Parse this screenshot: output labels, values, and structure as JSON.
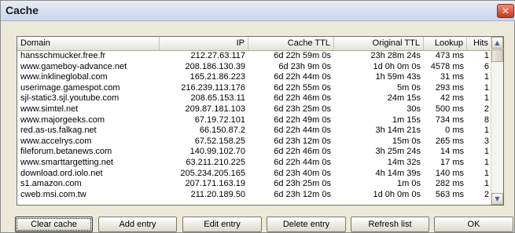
{
  "window": {
    "title": "Cache",
    "close_icon": "close-icon"
  },
  "table": {
    "columns": [
      "Domain",
      "IP",
      "Cache TTL",
      "Original TTL",
      "Lookup",
      "Hits"
    ],
    "rows": [
      [
        "hansschmucker.free.fr",
        "212.27.63.117",
        "6d 22h 59m  0s",
        "23h 28m 24s",
        "473 ms",
        "1"
      ],
      [
        "www.gameboy-advance.net",
        "208.186.130.39",
        "6d 23h  9m  0s",
        "1d  0h  0m  0s",
        "4578 ms",
        "6"
      ],
      [
        "www.inklineglobal.com",
        "165.21.86.223",
        "6d 22h 44m  0s",
        "1h 59m 43s",
        "31 ms",
        "1"
      ],
      [
        "userimage.gamespot.com",
        "216.239.113.176",
        "6d 22h 55m  0s",
        "5m  0s",
        "293 ms",
        "1"
      ],
      [
        "sjl-static3.sjl.youtube.com",
        "208.65.153.11",
        "6d 22h 46m  0s",
        "24m 15s",
        "42 ms",
        "1"
      ],
      [
        "www.simtel.net",
        "209.87.181.103",
        "6d 23h 25m  0s",
        "30s",
        "500 ms",
        "2"
      ],
      [
        "www.majorgeeks.com",
        "67.19.72.101",
        "6d 22h 49m  0s",
        "1m 15s",
        "734 ms",
        "8"
      ],
      [
        "red.as-us.falkag.net",
        "66.150.87.2",
        "6d 22h 44m  0s",
        "3h 14m 21s",
        "0 ms",
        "1"
      ],
      [
        "www.accelrys.com",
        "67.52.158.25",
        "6d 23h 12m  0s",
        "15m  0s",
        "265 ms",
        "3"
      ],
      [
        "fileforum.betanews.com",
        "140.99.102.70",
        "6d 22h 46m  0s",
        "3h 25m 24s",
        "14 ms",
        "1"
      ],
      [
        "www.smarttargetting.net",
        "63.211.210.225",
        "6d 22h 44m  0s",
        "14m 32s",
        "17 ms",
        "1"
      ],
      [
        "download.ord.iolo.net",
        "205.234.205.165",
        "6d 23h 40m  0s",
        "4h 14m 39s",
        "140 ms",
        "1"
      ],
      [
        "s1.amazon.com",
        "207.171.163.19",
        "6d 23h 25m  0s",
        "1m  0s",
        "282 ms",
        "1"
      ],
      [
        "cweb.msi.com.tw",
        "211.20.189.50",
        "6d 23h 12m  0s",
        "1d  0h  0m  0s",
        "563 ms",
        "2"
      ]
    ]
  },
  "scrollbar": {
    "up_icon": "scroll-up-icon",
    "down_icon": "scroll-down-icon"
  },
  "buttons": {
    "clear_cache": "Clear cache",
    "add_entry": "Add entry",
    "edit_entry": "Edit entry",
    "delete_entry": "Delete entry",
    "refresh_list": "Refresh list",
    "ok": "OK"
  }
}
